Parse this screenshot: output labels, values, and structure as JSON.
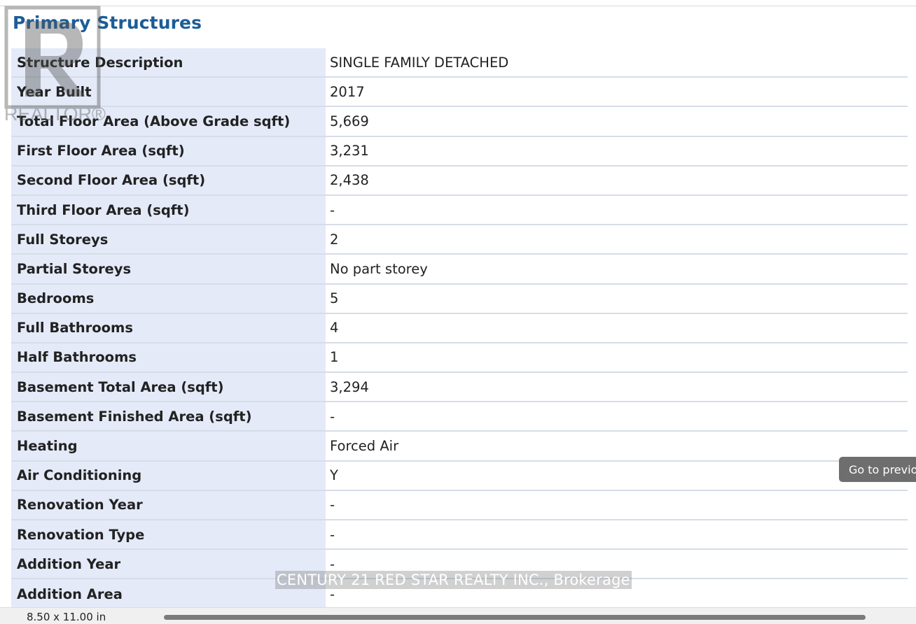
{
  "section": {
    "title": "Primary Structures"
  },
  "logo": {
    "text": "REALTOR®",
    "name": "realtor-logo"
  },
  "rows": [
    {
      "label": "Structure Description",
      "value": "SINGLE FAMILY DETACHED"
    },
    {
      "label": "Year Built",
      "value": "2017"
    },
    {
      "label": "Total Floor Area (Above Grade sqft)",
      "value": "5,669"
    },
    {
      "label": "First Floor Area (sqft)",
      "value": "3,231"
    },
    {
      "label": "Second Floor Area (sqft)",
      "value": "2,438"
    },
    {
      "label": "Third Floor Area (sqft)",
      "value": "-"
    },
    {
      "label": "Full Storeys",
      "value": "2"
    },
    {
      "label": "Partial Storeys",
      "value": "No part storey"
    },
    {
      "label": "Bedrooms",
      "value": "5"
    },
    {
      "label": "Full Bathrooms",
      "value": "4"
    },
    {
      "label": "Half Bathrooms",
      "value": "1"
    },
    {
      "label": "Basement Total Area (sqft)",
      "value": "3,294"
    },
    {
      "label": "Basement Finished Area (sqft)",
      "value": "-"
    },
    {
      "label": "Heating",
      "value": "Forced Air"
    },
    {
      "label": "Air Conditioning",
      "value": "Y"
    },
    {
      "label": "Renovation Year",
      "value": "-"
    },
    {
      "label": "Renovation Type",
      "value": "-"
    },
    {
      "label": "Addition Year",
      "value": "-"
    },
    {
      "label": "Addition Area",
      "value": "-"
    }
  ],
  "brokerage": "CENTURY 21 RED STAR REALTY INC., Brokerage",
  "tooltip": {
    "goto_previous": "Go to previous page"
  },
  "status": {
    "page_size": "8.50 x 11.00 in"
  },
  "colors": {
    "title": "#1d5c96",
    "label_bg": "#e4eaf8",
    "row_border": "#d6dde8",
    "tooltip_bg": "#6e6e6e"
  }
}
